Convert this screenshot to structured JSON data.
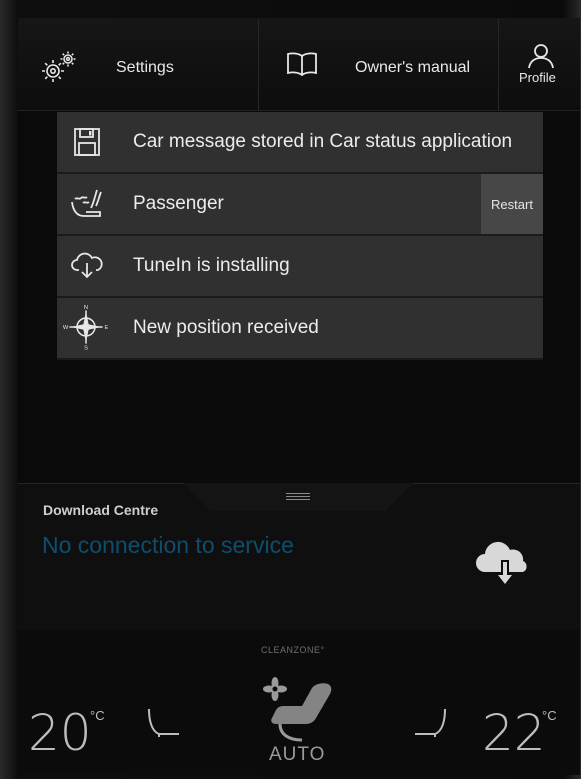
{
  "header": {
    "settings_label": "Settings",
    "manual_label": "Owner's manual",
    "profile_label": "Profile"
  },
  "notifications": [
    {
      "icon": "floppy-disk-icon",
      "text": "Car message stored in Car status application"
    },
    {
      "icon": "heated-seat-icon",
      "text": "Passenger",
      "action": "Restart"
    },
    {
      "icon": "cloud-download-icon",
      "text": "TuneIn is installing"
    },
    {
      "icon": "compass-icon",
      "text": "New position received",
      "compass": {
        "n": "N",
        "s": "S",
        "e": "E",
        "w": "W"
      }
    }
  ],
  "download_centre": {
    "title": "Download Centre",
    "status": "No connection to service",
    "status_color": "#0f4d6f"
  },
  "climate": {
    "cleanzone": "CLEANZONE°",
    "left_temp": "20",
    "right_temp": "22",
    "unit": "°C",
    "mode": "AUTO"
  }
}
